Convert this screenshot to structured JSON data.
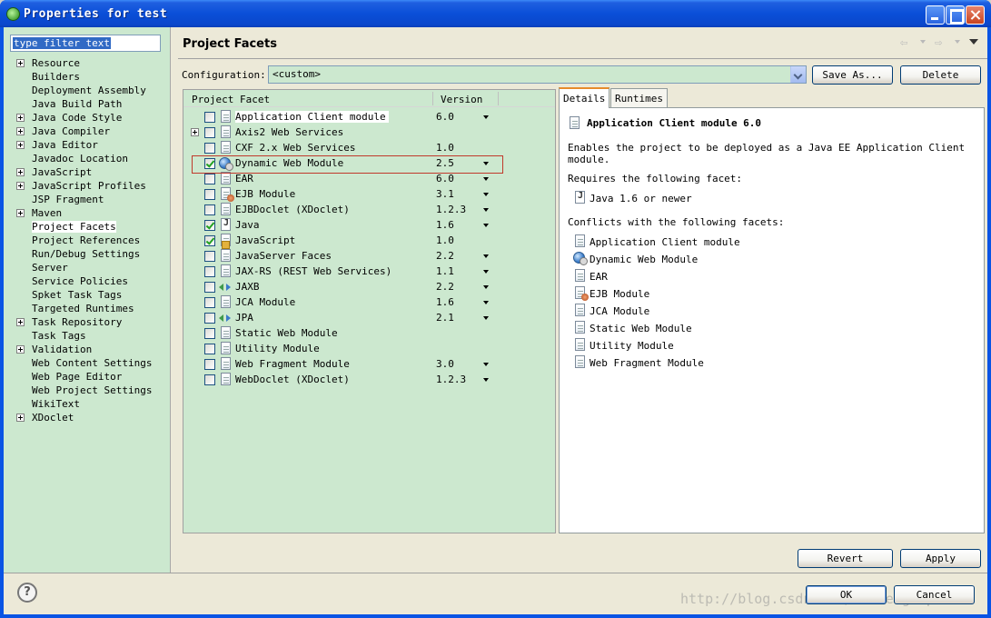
{
  "window": {
    "title": "Properties for test"
  },
  "filter": {
    "placeholder": "type filter text"
  },
  "tree": [
    {
      "label": "Resource",
      "expandable": true
    },
    {
      "label": "Builders",
      "expandable": false
    },
    {
      "label": "Deployment Assembly",
      "expandable": false
    },
    {
      "label": "Java Build Path",
      "expandable": false
    },
    {
      "label": "Java Code Style",
      "expandable": true
    },
    {
      "label": "Java Compiler",
      "expandable": true
    },
    {
      "label": "Java Editor",
      "expandable": true
    },
    {
      "label": "Javadoc Location",
      "expandable": false
    },
    {
      "label": "JavaScript",
      "expandable": true
    },
    {
      "label": "JavaScript Profiles",
      "expandable": true
    },
    {
      "label": "JSP Fragment",
      "expandable": false
    },
    {
      "label": "Maven",
      "expandable": true
    },
    {
      "label": "Project Facets",
      "expandable": false,
      "selected": true
    },
    {
      "label": "Project References",
      "expandable": false
    },
    {
      "label": "Run/Debug Settings",
      "expandable": false
    },
    {
      "label": "Server",
      "expandable": false
    },
    {
      "label": "Service Policies",
      "expandable": false
    },
    {
      "label": "Spket Task Tags",
      "expandable": false
    },
    {
      "label": "Targeted Runtimes",
      "expandable": false
    },
    {
      "label": "Task Repository",
      "expandable": true
    },
    {
      "label": "Task Tags",
      "expandable": false
    },
    {
      "label": "Validation",
      "expandable": true
    },
    {
      "label": "Web Content Settings",
      "expandable": false
    },
    {
      "label": "Web Page Editor",
      "expandable": false
    },
    {
      "label": "Web Project Settings",
      "expandable": false
    },
    {
      "label": "WikiText",
      "expandable": false
    },
    {
      "label": "XDoclet",
      "expandable": true
    }
  ],
  "page": {
    "title": "Project Facets"
  },
  "configuration": {
    "label": "Configuration:",
    "value": "<custom>",
    "save_as": "Save As...",
    "delete": "Delete"
  },
  "facets_table": {
    "col_facet": "Project Facet",
    "col_version": "Version",
    "rows": [
      {
        "name": "Application Client module",
        "version": "6.0",
        "checked": false,
        "icon": "page-icon",
        "dropdown": true,
        "expandable": false,
        "highlight": true
      },
      {
        "name": "Axis2 Web Services",
        "version": "",
        "checked": false,
        "icon": "page-icon",
        "dropdown": false,
        "expandable": true
      },
      {
        "name": "CXF 2.x Web Services",
        "version": "1.0",
        "checked": false,
        "icon": "page-icon",
        "dropdown": false,
        "expandable": false
      },
      {
        "name": "Dynamic Web Module",
        "version": "2.5",
        "checked": true,
        "icon": "globe-icon",
        "dropdown": true,
        "expandable": false
      },
      {
        "name": "EAR",
        "version": "6.0",
        "checked": false,
        "icon": "page-icon",
        "dropdown": true,
        "expandable": false
      },
      {
        "name": "EJB Module",
        "version": "3.1",
        "checked": false,
        "icon": "ejb-icon",
        "dropdown": true,
        "expandable": false
      },
      {
        "name": "EJBDoclet (XDoclet)",
        "version": "1.2.3",
        "checked": false,
        "icon": "page-icon",
        "dropdown": true,
        "expandable": false
      },
      {
        "name": "Java",
        "version": "1.6",
        "checked": true,
        "icon": "java-icon",
        "dropdown": true,
        "expandable": false
      },
      {
        "name": "JavaScript",
        "version": "1.0",
        "checked": true,
        "icon": "javascript-icon",
        "dropdown": false,
        "expandable": false
      },
      {
        "name": "JavaServer Faces",
        "version": "2.2",
        "checked": false,
        "icon": "page-icon",
        "dropdown": true,
        "expandable": false
      },
      {
        "name": "JAX-RS (REST Web Services)",
        "version": "1.1",
        "checked": false,
        "icon": "page-icon",
        "dropdown": true,
        "expandable": false
      },
      {
        "name": "JAXB",
        "version": "2.2",
        "checked": false,
        "icon": "arrows-icon",
        "dropdown": true,
        "expandable": false
      },
      {
        "name": "JCA Module",
        "version": "1.6",
        "checked": false,
        "icon": "page-icon",
        "dropdown": true,
        "expandable": false
      },
      {
        "name": "JPA",
        "version": "2.1",
        "checked": false,
        "icon": "arrows-icon",
        "dropdown": true,
        "expandable": false
      },
      {
        "name": "Static Web Module",
        "version": "",
        "checked": false,
        "icon": "page-icon",
        "dropdown": false,
        "expandable": false
      },
      {
        "name": "Utility Module",
        "version": "",
        "checked": false,
        "icon": "page-icon",
        "dropdown": false,
        "expandable": false
      },
      {
        "name": "Web Fragment Module",
        "version": "3.0",
        "checked": false,
        "icon": "page-icon",
        "dropdown": true,
        "expandable": false
      },
      {
        "name": "WebDoclet (XDoclet)",
        "version": "1.2.3",
        "checked": false,
        "icon": "page-icon",
        "dropdown": true,
        "expandable": false
      }
    ]
  },
  "tabs": {
    "details": "Details",
    "runtimes": "Runtimes"
  },
  "details": {
    "title": "Application Client module 6.0",
    "description": "Enables the project to be deployed as a Java EE Application Client module.",
    "requires_label": "Requires the following facet:",
    "requires": [
      {
        "name": "Java 1.6 or newer",
        "icon": "java-icon"
      }
    ],
    "conflicts_label": "Conflicts with the following facets:",
    "conflicts": [
      {
        "name": "Application Client module",
        "icon": "page-icon"
      },
      {
        "name": "Dynamic Web Module",
        "icon": "globe-icon"
      },
      {
        "name": "EAR",
        "icon": "page-icon"
      },
      {
        "name": "EJB Module",
        "icon": "ejb-icon"
      },
      {
        "name": "JCA Module",
        "icon": "page-icon"
      },
      {
        "name": "Static Web Module",
        "icon": "page-icon"
      },
      {
        "name": "Utility Module",
        "icon": "page-icon"
      },
      {
        "name": "Web Fragment Module",
        "icon": "page-icon"
      }
    ]
  },
  "buttons": {
    "revert": "Revert",
    "apply": "Apply",
    "ok": "OK",
    "cancel": "Cancel"
  },
  "watermark": "http://blog.csdn.net/clevergump",
  "colors": {
    "pane_green": "#cce8cf",
    "titlebar_blue": "#0a54e4",
    "highlight_red": "#c0392b"
  }
}
